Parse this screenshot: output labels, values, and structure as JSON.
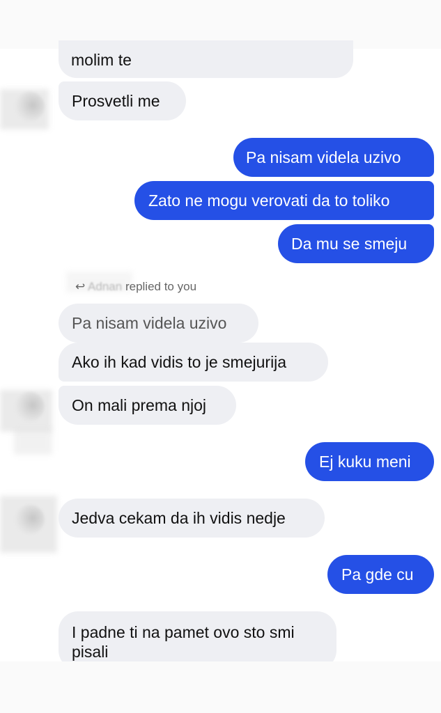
{
  "colors": {
    "incoming_bg": "#eeeff3",
    "outgoing_bg": "#2550e6",
    "outgoing_text": "#ffffff"
  },
  "reply": {
    "arrow": "↩",
    "name": "Adnan",
    "text": "replied to you"
  },
  "messages": [
    {
      "text": "molim te",
      "dir": "in"
    },
    {
      "text": "Prosvetli me",
      "dir": "in"
    },
    {
      "text": "Pa nisam videla uzivo",
      "dir": "out"
    },
    {
      "text": "Zato ne mogu verovati da to toliko",
      "dir": "out"
    },
    {
      "text": "Da mu se smeju",
      "dir": "out"
    },
    {
      "text": "Pa nisam videla uzivo",
      "dir": "quote"
    },
    {
      "text": "Ako ih kad vidis to je smejurija",
      "dir": "in"
    },
    {
      "text": "On mali prema njoj",
      "dir": "in"
    },
    {
      "text": "Ej kuku meni",
      "dir": "out"
    },
    {
      "text": "Jedva cekam da ih vidis nedje",
      "dir": "in"
    },
    {
      "text": "Pa gde cu",
      "dir": "out"
    },
    {
      "text": "I padne ti na pamet ovo sto smi pisali",
      "dir": "in"
    }
  ]
}
